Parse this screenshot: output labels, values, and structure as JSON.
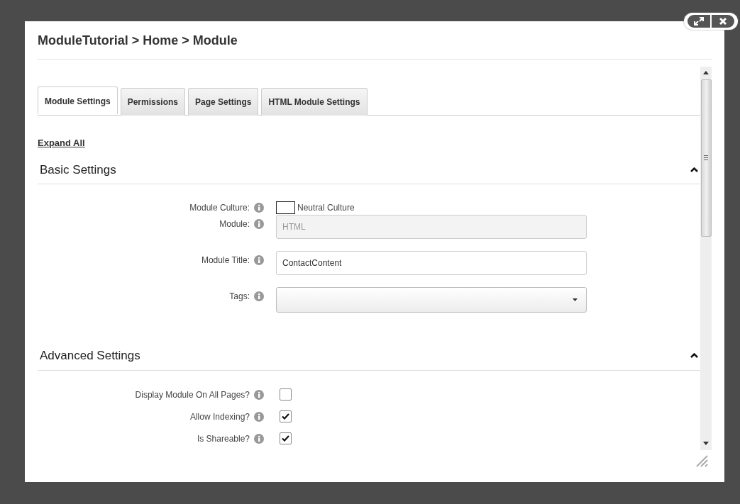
{
  "dialog": {
    "title": "ModuleTutorial > Home > Module"
  },
  "tabs": [
    {
      "label": "Module Settings",
      "selected": true
    },
    {
      "label": "Permissions",
      "selected": false
    },
    {
      "label": "Page Settings",
      "selected": false
    },
    {
      "label": "HTML Module Settings",
      "selected": false
    }
  ],
  "expand_all": "Expand All",
  "sections": [
    {
      "title": "Basic Settings",
      "expanded": true,
      "fields": [
        {
          "kind": "culture",
          "label": "Module Culture:",
          "value": "Neutral Culture"
        },
        {
          "kind": "readonly",
          "label": "Module:",
          "value": "HTML"
        },
        {
          "kind": "text",
          "label": "Module Title:",
          "value": "ContactContent"
        },
        {
          "kind": "tags",
          "label": "Tags:"
        }
      ]
    },
    {
      "title": "Advanced Settings",
      "expanded": true,
      "fields": [
        {
          "kind": "checkbox",
          "label": "Display Module On All Pages?",
          "checked": false
        },
        {
          "kind": "checkbox",
          "label": "Allow Indexing?",
          "checked": true
        },
        {
          "kind": "checkbox",
          "label": "Is Shareable?",
          "checked": true
        }
      ]
    }
  ]
}
